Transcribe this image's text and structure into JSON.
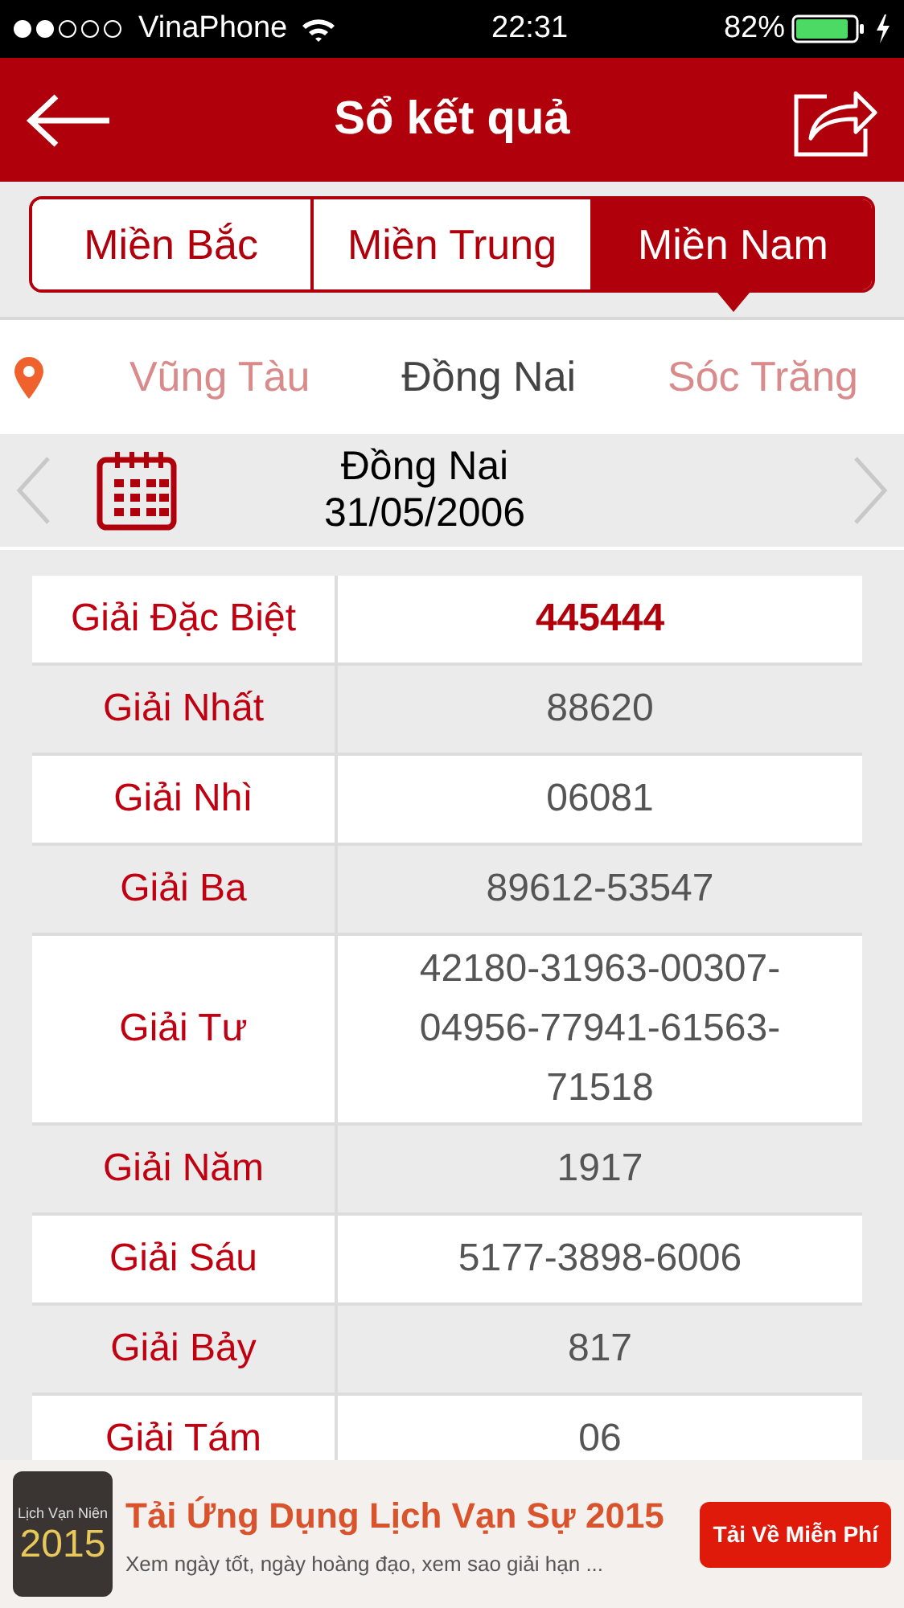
{
  "status_bar": {
    "carrier": "VinaPhone",
    "time": "22:31",
    "battery": "82%"
  },
  "header": {
    "title": "Sổ kết quả"
  },
  "regions": [
    {
      "label": "Miền Bắc",
      "selected": false
    },
    {
      "label": "Miền Trung",
      "selected": false
    },
    {
      "label": "Miền Nam",
      "selected": true
    }
  ],
  "provinces": [
    {
      "label": "Vũng Tàu",
      "selected": false
    },
    {
      "label": "Đồng Nai",
      "selected": true
    },
    {
      "label": "Sóc Trăng",
      "selected": false
    }
  ],
  "date_bar": {
    "province": "Đồng Nai",
    "date": "31/05/2006"
  },
  "results": [
    {
      "prize": "Giải Đặc Biệt",
      "value": "445444",
      "kind": "special"
    },
    {
      "prize": "Giải Nhất",
      "value": "88620",
      "kind": "normal"
    },
    {
      "prize": "Giải Nhì",
      "value": "06081",
      "kind": "normal"
    },
    {
      "prize": "Giải Ba",
      "value": "89612-53547",
      "kind": "normal"
    },
    {
      "prize": "Giải Tư",
      "value": "42180-31963-00307-04956-77941-61563-71518",
      "kind": "normal"
    },
    {
      "prize": "Giải Năm",
      "value": "1917",
      "kind": "normal"
    },
    {
      "prize": "Giải Sáu",
      "value": "5177-3898-6006",
      "kind": "normal"
    },
    {
      "prize": "Giải Bảy",
      "value": "817",
      "kind": "normal"
    },
    {
      "prize": "Giải Tám",
      "value": "06",
      "kind": "normal"
    }
  ],
  "ad": {
    "icon_caption": "Lịch Vạn Niên",
    "icon_year": "2015",
    "headline": "Tải Ứng Dụng Lịch Vạn Sự 2015",
    "subline": "Xem ngày tốt, ngày hoàng đạo, xem sao giải hạn ...",
    "button": "Tải Về Miễn Phí"
  }
}
